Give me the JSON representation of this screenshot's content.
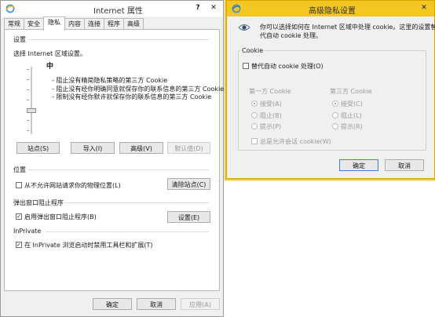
{
  "left": {
    "title": "Internet 属性",
    "help": "?",
    "close": "✕",
    "tabs": [
      "常规",
      "安全",
      "隐私",
      "内容",
      "连接",
      "程序",
      "高级"
    ],
    "settings": {
      "header": "设置",
      "zone_prompt": "选择 Internet 区域设置。",
      "level": "中",
      "bullets": [
        "- 阻止没有精简隐私策略的第三方 Cookie",
        "- 阻止没有经你明确同意就保存你的联系信息的第三方 Cookie",
        "- 限制没有经你默许就保存你的联系信息的第三方 Cookie"
      ],
      "slider_level": 0.35,
      "buttons": [
        "站点(S)",
        "导入(I)",
        "高级(V)",
        "默认值(D)"
      ]
    },
    "location": {
      "header": "位置",
      "checkbox": "从不允许网站请求你的物理位置(L)",
      "checked": false,
      "clear_button": "清除站点(C)"
    },
    "popup": {
      "header": "弹出窗口阻止程序",
      "checkbox": "启用弹出窗口阻止程序(B)",
      "checked": true,
      "settings_button": "设置(E)"
    },
    "inprivate": {
      "header": "InPrivate",
      "checkbox": "在 InPrivate 浏览启动时禁用工具栏和扩展(T)",
      "checked": true
    },
    "footer": {
      "ok": "确定",
      "cancel": "取消",
      "apply": "应用(A)"
    }
  },
  "right": {
    "title": "高级隐私设置",
    "close": "✕",
    "description_line1": "你可以选择如何在 Internet 区域中处理 cookie。这里的设置替",
    "description_line2": "代自动 cookie 处理。",
    "cookie_group": "Cookie",
    "override_checkbox": "替代自动 cookie 处理(O)",
    "override_checked": false,
    "first_party": {
      "header": "第一方 Cookie",
      "options": [
        "接受(A)",
        "阻止(B)",
        "提示(P)"
      ],
      "selected": 0
    },
    "third_party": {
      "header": "第三方 Cookie",
      "options": [
        "接受(C)",
        "阻止(L)",
        "提示(R)"
      ],
      "selected": 0
    },
    "session_checkbox": "总是允许会话 cookie(W)",
    "session_checked": false,
    "ok": "确定",
    "cancel": "取消"
  },
  "colors": {
    "accent_title": "#f3c623",
    "border": "#d9a400"
  }
}
